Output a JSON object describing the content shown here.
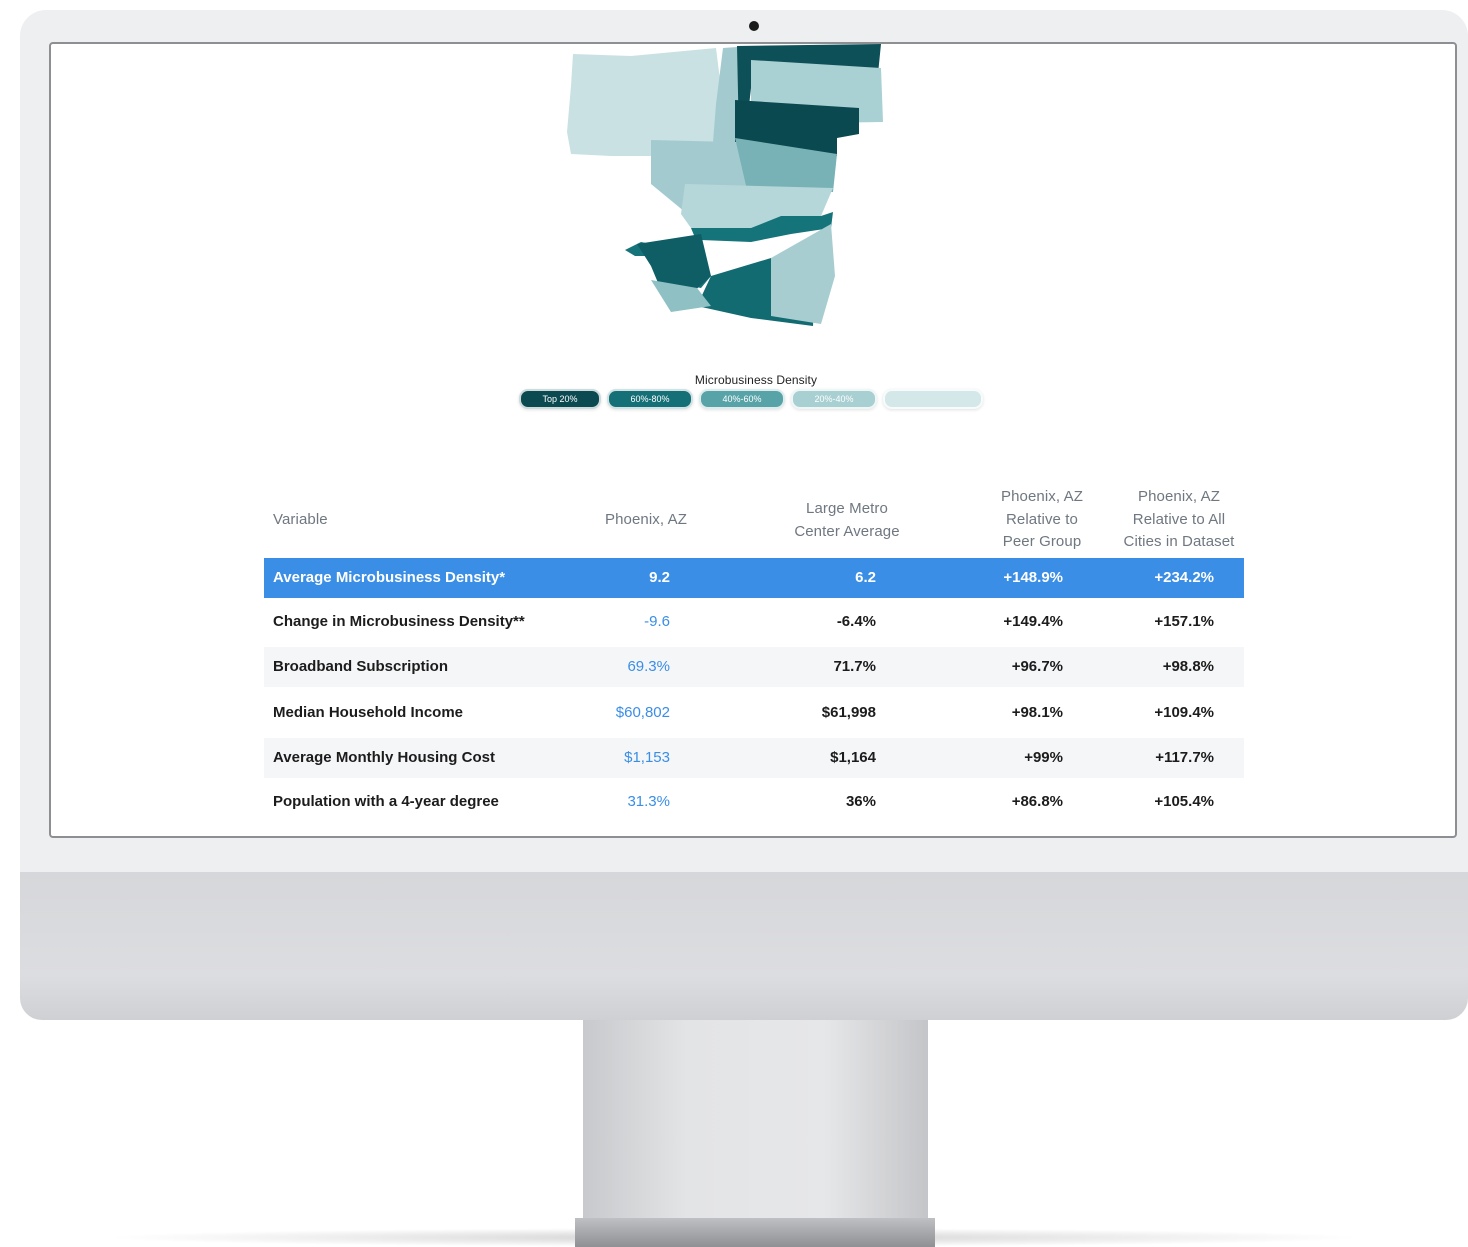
{
  "map": {
    "legend_title": "Microbusiness Density",
    "legend": [
      {
        "label": "Top 20%",
        "color": "#0c4a52"
      },
      {
        "label": "60%-80%",
        "color": "#156f76"
      },
      {
        "label": "40%-60%",
        "color": "#58a3a8"
      },
      {
        "label": "20%-40%",
        "color": "#a8cfd1"
      },
      {
        "label": "",
        "color": "#d4e8e9"
      }
    ]
  },
  "table": {
    "headers": {
      "variable": "Variable",
      "phoenix": "Phoenix, AZ",
      "avg_l1": "Large Metro",
      "avg_l2": "Center Average",
      "peer_l1": "Phoenix, AZ",
      "peer_l2": "Relative to",
      "peer_l3": "Peer Group",
      "all_l1": "Phoenix, AZ",
      "all_l2": "Relative to All",
      "all_l3": "Cities in Dataset"
    },
    "rows": [
      {
        "variable": "Average Microbusiness Density*",
        "phoenix": "9.2",
        "average": "6.2",
        "peer": "+148.9%",
        "all": "+234.2%"
      },
      {
        "variable": "Change in Microbusiness Density**",
        "phoenix": "-9.6",
        "average": "-6.4%",
        "peer": "+149.4%",
        "all": "+157.1%"
      },
      {
        "variable": "Broadband Subscription",
        "phoenix": "69.3%",
        "average": "71.7%",
        "peer": "+96.7%",
        "all": "+98.8%"
      },
      {
        "variable": "Median Household Income",
        "phoenix": "$60,802",
        "average": "$61,998",
        "peer": "+98.1%",
        "all": "+109.4%"
      },
      {
        "variable": "Average Monthly Housing Cost",
        "phoenix": "$1,153",
        "average": "$1,164",
        "peer": "+99%",
        "all": "+117.7%"
      },
      {
        "variable": "Population with a 4-year degree",
        "phoenix": "31.3%",
        "average": "36%",
        "peer": "+86.8%",
        "all": "+105.4%"
      }
    ]
  }
}
